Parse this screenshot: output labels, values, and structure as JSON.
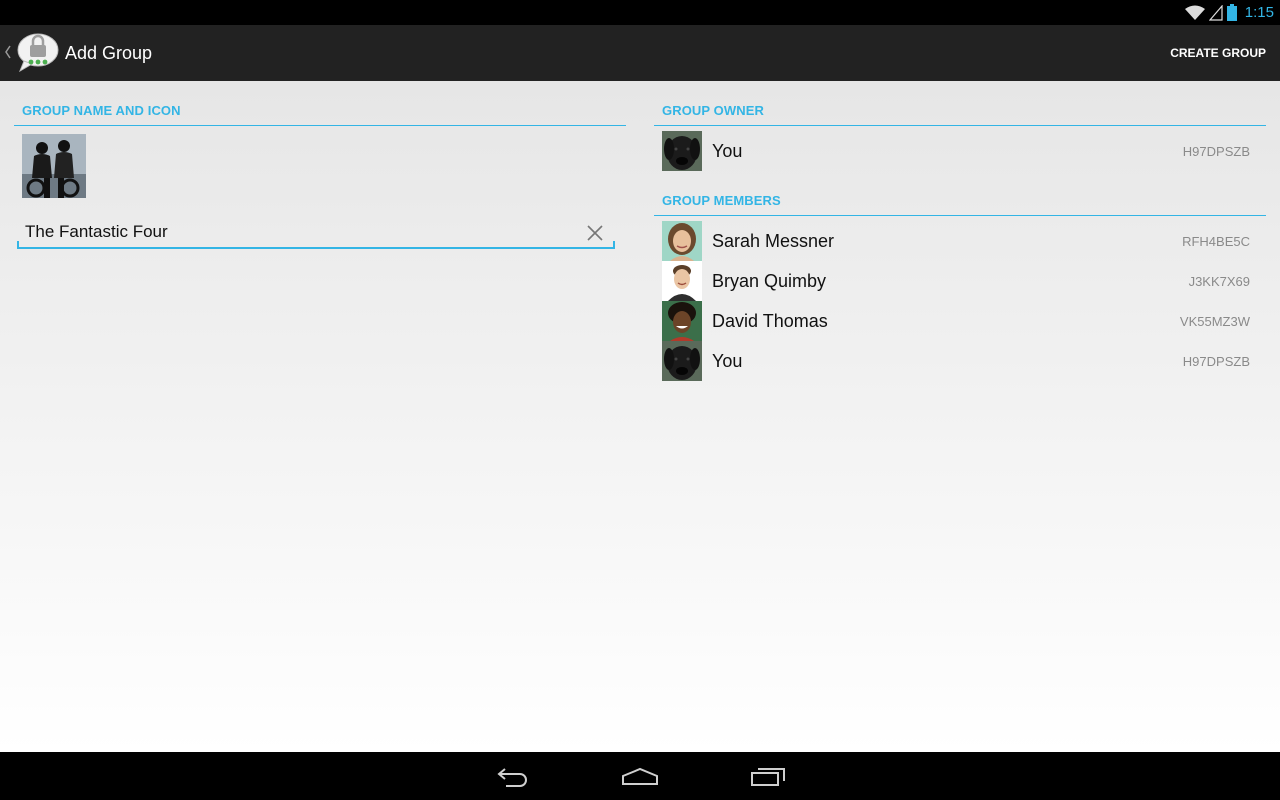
{
  "status_bar": {
    "time": "1:15",
    "icons": [
      "wifi-icon",
      "signal-icon",
      "battery-icon"
    ]
  },
  "action_bar": {
    "up_icon": "chevron-left-icon",
    "app_icon": "secure-chat-lock-icon",
    "title": "Add Group",
    "create_label": "CREATE GROUP"
  },
  "group_name_section": {
    "header": "GROUP NAME AND ICON",
    "icon": "group-photo",
    "name_value": "The Fantastic Four",
    "clear_icon": "clear-icon"
  },
  "owner_section": {
    "header": "GROUP OWNER",
    "owner": {
      "name": "You",
      "id": "H97DPSZB",
      "avatar": "dog-avatar"
    }
  },
  "members_section": {
    "header": "GROUP MEMBERS",
    "members": [
      {
        "name": "Sarah Messner",
        "id": "RFH4BE5C",
        "avatar": "woman-avatar"
      },
      {
        "name": "Bryan Quimby",
        "id": "J3KK7X69",
        "avatar": "man-avatar"
      },
      {
        "name": "David Thomas",
        "id": "VK55MZ3W",
        "avatar": "smiling-man-avatar"
      },
      {
        "name": "You",
        "id": "H97DPSZB",
        "avatar": "dog-avatar"
      }
    ]
  },
  "nav_bar": {
    "icons": [
      "back-icon",
      "home-icon",
      "recent-apps-icon"
    ]
  },
  "colors": {
    "accent": "#33b5e5",
    "action_bar": "#222222",
    "id_text": "#8a8a8a"
  }
}
